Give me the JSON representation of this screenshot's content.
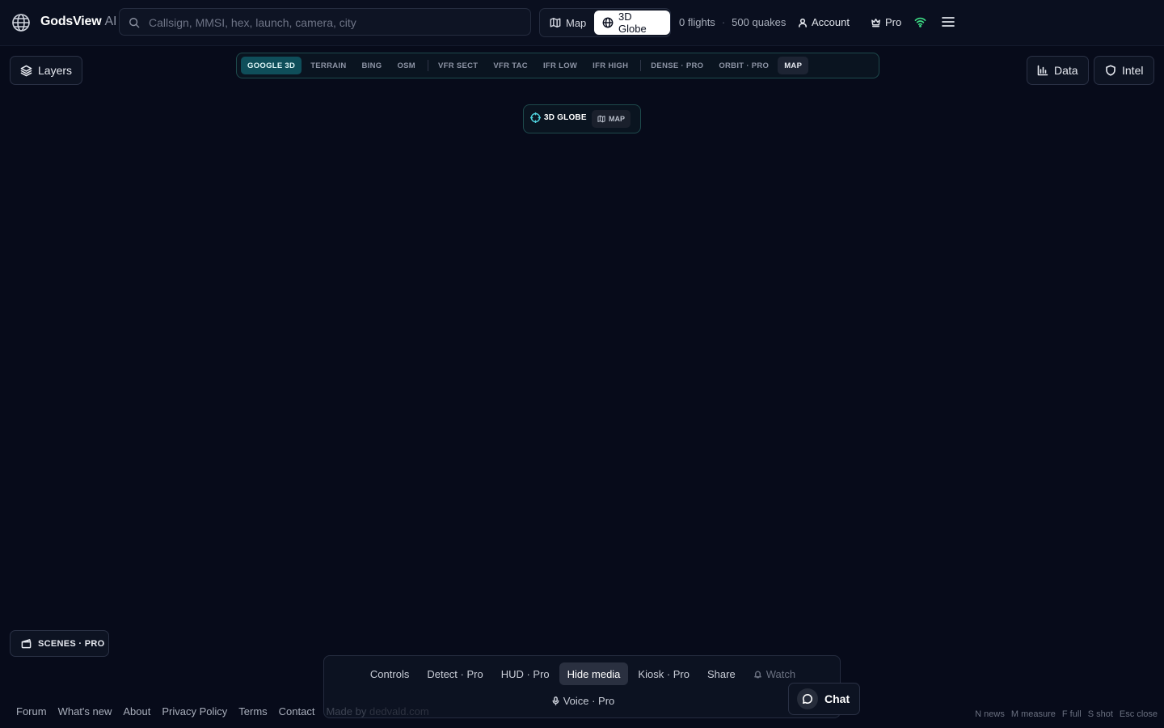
{
  "app": {
    "brand": "GodsView",
    "brand_suffix": "AI"
  },
  "search": {
    "placeholder": "Callsign, MMSI, hex, launch, camera, city",
    "value": ""
  },
  "view_toggle": {
    "map_label": "Map",
    "globe_label": "3D Globe",
    "selected": "3D Globe"
  },
  "stats": {
    "flights": "0 flights",
    "separator": "·",
    "quakes": "500 quakes"
  },
  "header": {
    "account_label": "Account",
    "pro_label": "Pro",
    "status_color": "#3ddc84"
  },
  "left_panel": {
    "layers_label": "Layers"
  },
  "basemaps": {
    "items": [
      "GOOGLE 3D",
      "TERRAIN",
      "BING",
      "OSM",
      "VFR SECT",
      "VFR TAC",
      "IFR LOW",
      "IFR HIGH",
      "DENSE · PRO",
      "ORBIT · PRO",
      "MAP"
    ],
    "selected": "GOOGLE 3D",
    "accent": "#0f4e5a"
  },
  "right_panel": {
    "data_label": "Data",
    "intel_label": "Intel"
  },
  "center_toggle": {
    "globe_label": "3D GLOBE",
    "map_label": "MAP"
  },
  "scenes": {
    "label": "SCENES · PRO"
  },
  "bottom_bar": {
    "buttons": [
      "Controls",
      "Detect · Pro",
      "HUD · Pro",
      "Hide media",
      "Kiosk · Pro",
      "Share",
      "Watch"
    ],
    "active": "Hide media",
    "voice_label": "Voice · Pro"
  },
  "chat": {
    "label": "Chat"
  },
  "footer": {
    "links": [
      "Forum",
      "What's new",
      "About",
      "Privacy Policy",
      "Terms",
      "Contact"
    ],
    "made_with": "Made by",
    "made_site": "dedvald.com"
  },
  "shortcuts": [
    "N news",
    "M measure",
    "F full",
    "S shot",
    "Esc close"
  ]
}
